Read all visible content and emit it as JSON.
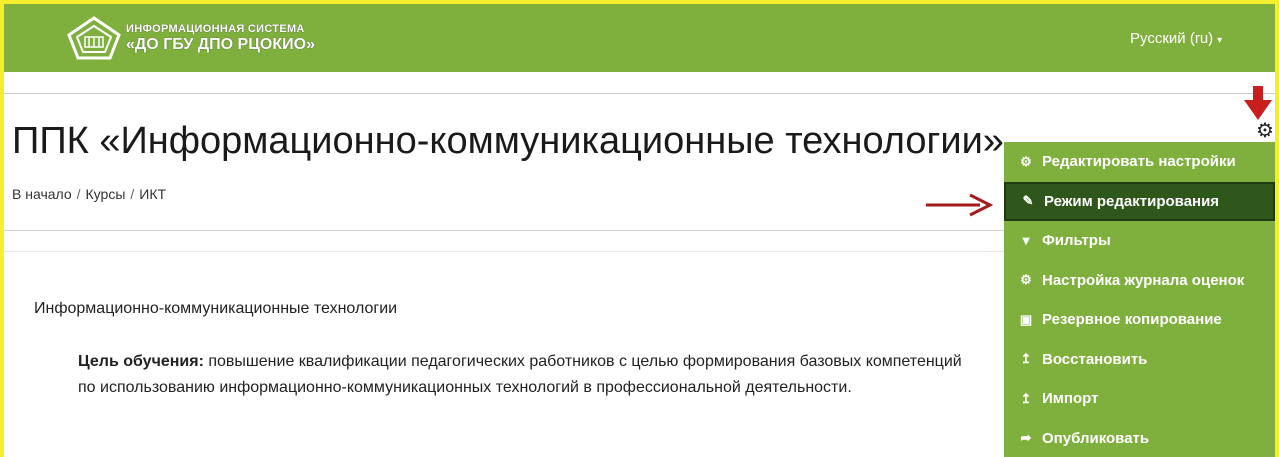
{
  "header": {
    "logo_line1": "ИНФОРМАЦИОННАЯ СИСТЕМА",
    "logo_line2": "«ДО ГБУ ДПО РЦОКИО»",
    "language": "Русский (ru)",
    "brand_color": "#7fb03d"
  },
  "page": {
    "title": "ППК «Информационно-коммуникационные технологии»",
    "breadcrumb": [
      "В начало",
      "Курсы",
      "ИКТ"
    ],
    "breadcrumb_sep": "/"
  },
  "content": {
    "section_title": "Информационно-коммуникационные технологии",
    "goal_label": "Цель обучения:",
    "goal_text": " повышение квалификации педагогических работников с целью формирования базовых компетенций по использованию информационно-коммуникационных технологий в профессиональной деятельности."
  },
  "settings_menu": {
    "trigger_icon": "gear-icon",
    "items": [
      {
        "label": "Редактировать настройки",
        "icon": "gear-icon"
      },
      {
        "label": "Режим редактирования",
        "icon": "pencil-icon",
        "active": true
      },
      {
        "label": "Фильтры",
        "icon": "filter-icon"
      },
      {
        "label": "Настройка журнала оценок",
        "icon": "gear-icon"
      },
      {
        "label": "Резервное копирование",
        "icon": "backup-icon"
      },
      {
        "label": "Восстановить",
        "icon": "upload-icon"
      },
      {
        "label": "Импорт",
        "icon": "upload-icon"
      },
      {
        "label": "Опубликовать",
        "icon": "share-icon"
      }
    ],
    "active_color": "#2f561b",
    "annotation_arrow_color": "#b01e1e"
  }
}
